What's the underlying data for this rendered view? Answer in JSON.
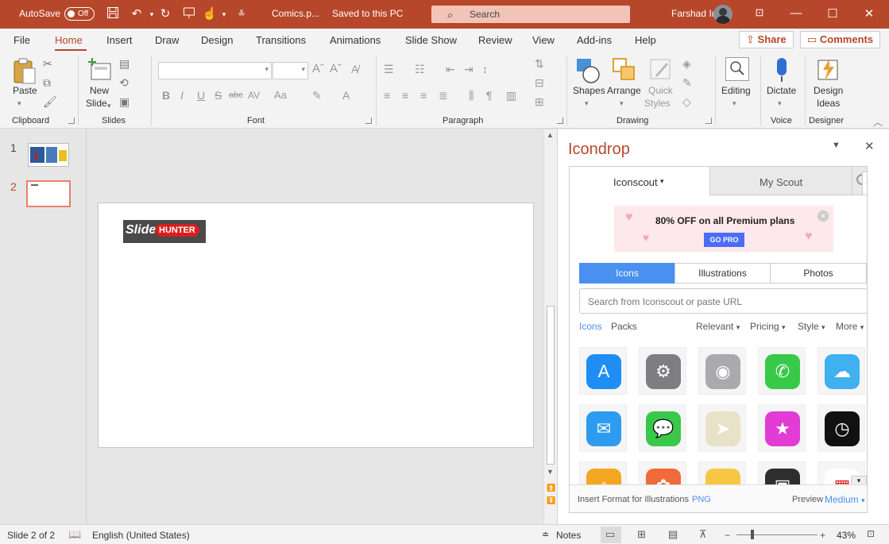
{
  "titlebar": {
    "autosave_label": "AutoSave",
    "autosave_state": "Off",
    "doc_title": "Comics.p...",
    "save_status": "Saved to this PC",
    "search_placeholder": "Search",
    "user_name": "Farshad Iqbal",
    "accent": "#b7472a"
  },
  "tabs": [
    "File",
    "Home",
    "Insert",
    "Draw",
    "Design",
    "Transitions",
    "Animations",
    "Slide Show",
    "Review",
    "View",
    "Add-ins",
    "Help"
  ],
  "active_tab": "Home",
  "share_label": "Share",
  "comments_label": "Comments",
  "ribbon": {
    "paste_label": "Paste",
    "new_slide_l1": "New",
    "new_slide_l2": "Slide",
    "shapes_label": "Shapes",
    "arrange_label": "Arrange",
    "quick_styles_l1": "Quick",
    "quick_styles_l2": "Styles",
    "editing_label": "Editing",
    "dictate_label": "Dictate",
    "design_ideas_l1": "Design",
    "design_ideas_l2": "Ideas",
    "groups": {
      "clipboard": "Clipboard",
      "slides": "Slides",
      "font": "Font",
      "paragraph": "Paragraph",
      "drawing": "Drawing",
      "voice": "Voice",
      "designer": "Designer"
    }
  },
  "thumbnails": [
    {
      "number": "1"
    },
    {
      "number": "2"
    }
  ],
  "slide_logo": {
    "part1": "Slide",
    "part2": "HUNTER"
  },
  "pane": {
    "title": "Icondrop",
    "tab_iconscout": "Iconscout",
    "tab_myscout": "My Scout",
    "promo_text": "80% OFF on all Premium plans",
    "promo_button": "GO PRO",
    "filters": [
      "Icons",
      "Illustrations",
      "Photos"
    ],
    "search_placeholder": "Search from Iconscout or paste URL",
    "subtabs": [
      "Icons",
      "Packs"
    ],
    "sort_options": [
      "Relevant",
      "Pricing",
      "Style",
      "More"
    ],
    "footer_insert_label": "Insert Format for Illustrations",
    "footer_insert_value": "PNG",
    "footer_preview_label": "Preview",
    "footer_preview_value": "Medium",
    "icons": [
      {
        "name": "app-store-icon",
        "color": "#1e8ef5"
      },
      {
        "name": "settings-icon",
        "color": "#7d7d82"
      },
      {
        "name": "camera-icon",
        "color": "#a9a9ae"
      },
      {
        "name": "phone-icon",
        "color": "#38c948"
      },
      {
        "name": "weather-icon",
        "color": "#3fb0f0"
      },
      {
        "name": "mail-icon",
        "color": "#2d9bef"
      },
      {
        "name": "messages-icon",
        "color": "#3ac84a"
      },
      {
        "name": "maps-icon",
        "color": "#e8e2c9"
      },
      {
        "name": "itunes-star-icon",
        "color": "#e33bd6"
      },
      {
        "name": "clock-icon",
        "color": "#111111"
      },
      {
        "name": "home-icon",
        "color": "#f5a623"
      },
      {
        "name": "photos-icon",
        "color": "#f06a3a"
      },
      {
        "name": "notes-icon",
        "color": "#f7c744"
      },
      {
        "name": "facetime-icon",
        "color": "#2e2e2e"
      },
      {
        "name": "calendar-icon",
        "color": "#ffffff"
      }
    ]
  },
  "status": {
    "slide_info": "Slide 2 of 2",
    "language": "English (United States)",
    "notes_label": "Notes",
    "zoom": "43%"
  }
}
